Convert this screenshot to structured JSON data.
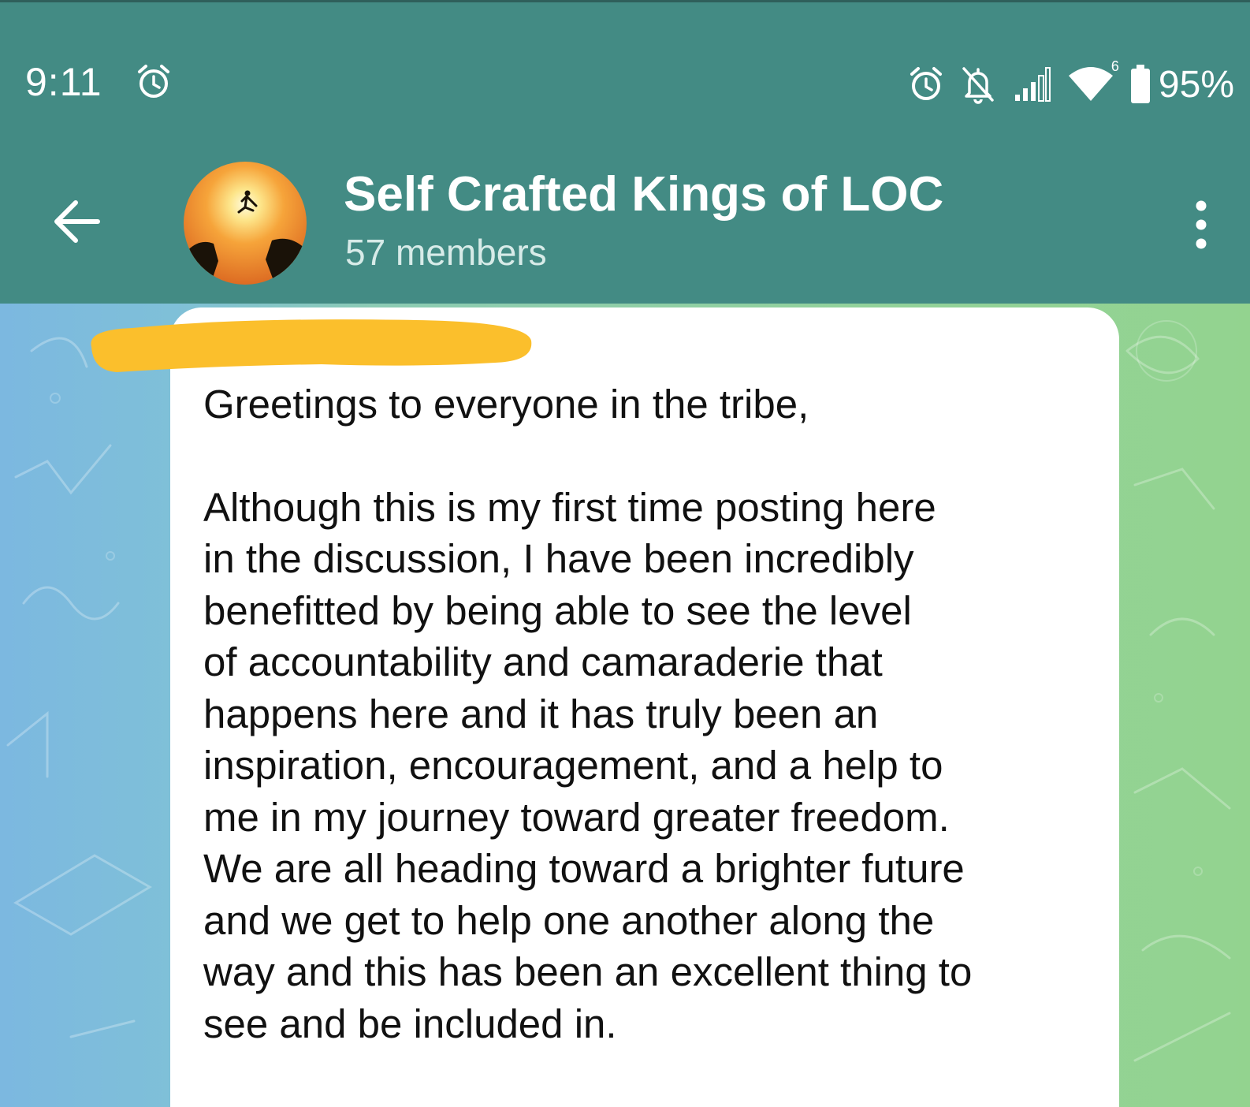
{
  "status_bar": {
    "time": "9:11",
    "battery_percent": "95%",
    "network_badge": "6",
    "icons": [
      "alarm-icon",
      "alarm-icon",
      "bell-muted-icon",
      "signal-icon",
      "wifi-icon",
      "battery-icon"
    ]
  },
  "header": {
    "title": "Self Crafted Kings of LOC",
    "subtitle": "57 members",
    "back_icon": "arrow-left-icon",
    "menu_icon": "more-vertical-icon",
    "colors": {
      "header_bg": "#438b84",
      "title": "#ffffff",
      "subtitle": "#d7ebe8"
    }
  },
  "message": {
    "sender_redacted": true,
    "greeting": "Greetings to everyone in the tribe,",
    "body_lines": [
      "Although this is my first time posting here",
      "in the discussion, I have been incredibly",
      "benefitted by being able to see the level",
      "of accountability and camaraderie that",
      "happens here and it has truly been an",
      "inspiration, encouragement, and a help to",
      "me in my journey toward greater freedom.",
      "We are all heading toward a brighter future",
      "and we get to help one another along the",
      "way and this has been an excellent thing to",
      "see and be included in."
    ],
    "colors": {
      "bubble_bg": "#ffffff",
      "redaction": "#fbbf2c",
      "text": "#111111"
    }
  }
}
